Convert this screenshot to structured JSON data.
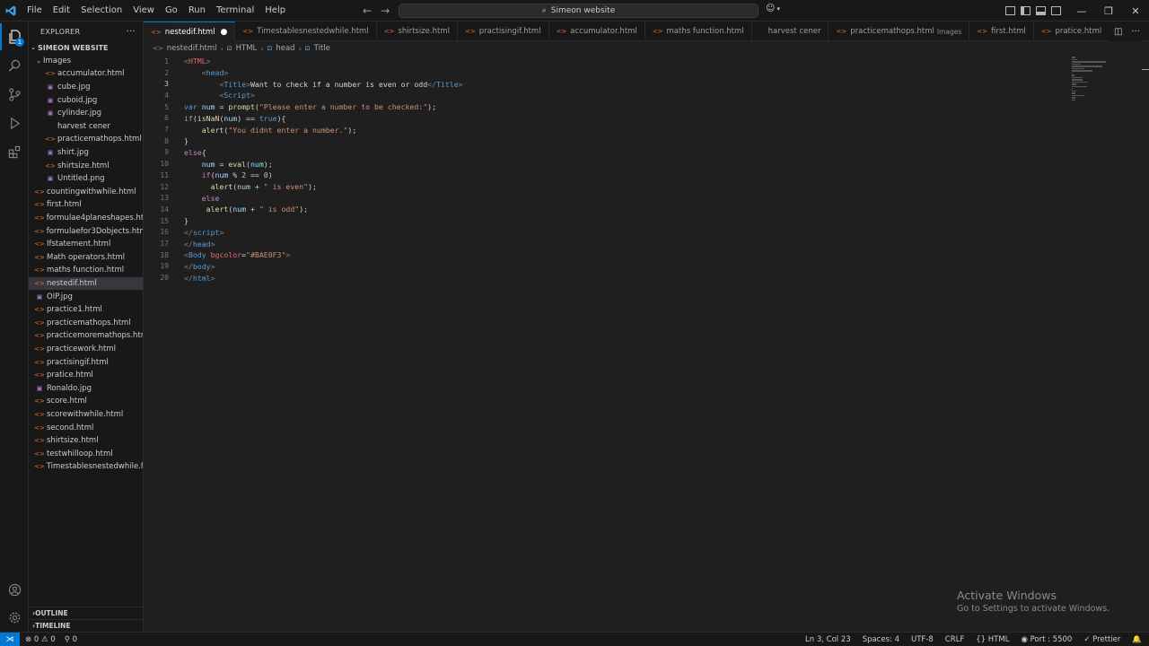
{
  "menu": [
    "File",
    "Edit",
    "Selection",
    "View",
    "Go",
    "Run",
    "Terminal",
    "Help"
  ],
  "command_center": "Simeon website",
  "explorer": {
    "title": "EXPLORER",
    "root": "SIMEON WEBSITE",
    "items": [
      {
        "label": "Images",
        "kind": "folder",
        "indent": 1
      },
      {
        "label": "accumulator.html",
        "kind": "html",
        "indent": 2
      },
      {
        "label": "cube.jpg",
        "kind": "img",
        "indent": 2
      },
      {
        "label": "cuboid.jpg",
        "kind": "img",
        "indent": 2
      },
      {
        "label": "cylinder.jpg",
        "kind": "img",
        "indent": 2
      },
      {
        "label": "harvest cener",
        "kind": "none",
        "indent": 2
      },
      {
        "label": "practicemathops.html",
        "kind": "html",
        "indent": 2
      },
      {
        "label": "shirt.jpg",
        "kind": "img",
        "indent": 2
      },
      {
        "label": "shirtsize.html",
        "kind": "html",
        "indent": 2
      },
      {
        "label": "Untitled.png",
        "kind": "img",
        "indent": 2
      },
      {
        "label": "countingwithwhile.html",
        "kind": "html",
        "indent": 1
      },
      {
        "label": "first.html",
        "kind": "html",
        "indent": 1
      },
      {
        "label": "formulae4planeshapes.ht...",
        "kind": "html",
        "indent": 1
      },
      {
        "label": "formulaefor3Dobjects.html",
        "kind": "html",
        "indent": 1
      },
      {
        "label": "Ifstatement.html",
        "kind": "html",
        "indent": 1
      },
      {
        "label": "Math operators.html",
        "kind": "html",
        "indent": 1
      },
      {
        "label": "maths function.html",
        "kind": "html",
        "indent": 1
      },
      {
        "label": "nestedif.html",
        "kind": "html",
        "indent": 1,
        "selected": true
      },
      {
        "label": "OIP.jpg",
        "kind": "img",
        "indent": 1
      },
      {
        "label": "practice1.html",
        "kind": "html",
        "indent": 1
      },
      {
        "label": "practicemathops.html",
        "kind": "html",
        "indent": 1
      },
      {
        "label": "practicemoremathops.html",
        "kind": "html",
        "indent": 1
      },
      {
        "label": "practicework.html",
        "kind": "html",
        "indent": 1
      },
      {
        "label": "practisingif.html",
        "kind": "html",
        "indent": 1
      },
      {
        "label": "pratice.html",
        "kind": "html",
        "indent": 1
      },
      {
        "label": "Ronaldo.jpg",
        "kind": "img",
        "indent": 1
      },
      {
        "label": "score.html",
        "kind": "html",
        "indent": 1
      },
      {
        "label": "scorewithwhile.html",
        "kind": "html",
        "indent": 1
      },
      {
        "label": "second.html",
        "kind": "html",
        "indent": 1
      },
      {
        "label": "shirtsize.html",
        "kind": "html",
        "indent": 1
      },
      {
        "label": "testwhilloop.html",
        "kind": "html",
        "indent": 1
      },
      {
        "label": "Timestablesnestedwhile.h...",
        "kind": "html",
        "indent": 1
      }
    ],
    "outline": "OUTLINE",
    "timeline": "TIMELINE"
  },
  "tabs": [
    {
      "label": "nestedif.html",
      "active": true,
      "dirty": true
    },
    {
      "label": "Timestablesnestedwhile.html"
    },
    {
      "label": "shirtsize.html"
    },
    {
      "label": "practisingif.html"
    },
    {
      "label": "accumulator.html"
    },
    {
      "label": "maths function.html"
    },
    {
      "label": "harvest cener",
      "noicon": true
    },
    {
      "label": "practicemathops.html",
      "desc": "Images"
    },
    {
      "label": "first.html"
    },
    {
      "label": "pratice.html"
    }
  ],
  "breadcrumb": [
    "nestedif.html",
    "HTML",
    "head",
    "Title"
  ],
  "editor": {
    "current_line": 3,
    "lines": [
      [
        [
          "brk",
          "<"
        ],
        [
          "html",
          "HTML"
        ],
        [
          "brk",
          ">"
        ]
      ],
      [
        [
          "plain",
          "    "
        ],
        [
          "brk",
          "<"
        ],
        [
          "tag",
          "head"
        ],
        [
          "brk",
          ">"
        ]
      ],
      [
        [
          "plain",
          "        "
        ],
        [
          "brk",
          "<"
        ],
        [
          "tag",
          "Title"
        ],
        [
          "brk",
          ">"
        ],
        [
          "plain",
          "Want to check if a number is even or odd"
        ],
        [
          "brk",
          "</"
        ],
        [
          "tag",
          "Title"
        ],
        [
          "brk",
          ">"
        ]
      ],
      [
        [
          "plain",
          "        "
        ],
        [
          "brk",
          "<"
        ],
        [
          "tag",
          "Script"
        ],
        [
          "brk",
          ">"
        ]
      ],
      [
        [
          "tag",
          "var"
        ],
        [
          "plain",
          " "
        ],
        [
          "var",
          "num"
        ],
        [
          "plain",
          " = "
        ],
        [
          "fn",
          "prompt"
        ],
        [
          "plain",
          "("
        ],
        [
          "str",
          "\"Please enter a number to be checked:\""
        ],
        [
          "plain",
          ");"
        ]
      ],
      [
        [
          "kw",
          "if"
        ],
        [
          "plain",
          "("
        ],
        [
          "fn",
          "isNaN"
        ],
        [
          "plain",
          "("
        ],
        [
          "var",
          "num"
        ],
        [
          "plain",
          ") == "
        ],
        [
          "tag",
          "true"
        ],
        [
          "plain",
          "){"
        ]
      ],
      [
        [
          "plain",
          "    "
        ],
        [
          "fn",
          "alert"
        ],
        [
          "plain",
          "("
        ],
        [
          "str",
          "\"You didnt enter a number.\""
        ],
        [
          "plain",
          ");"
        ]
      ],
      [
        [
          "plain",
          "}"
        ]
      ],
      [
        [
          "kw",
          "else"
        ],
        [
          "plain",
          "{"
        ]
      ],
      [
        [
          "plain",
          "    "
        ],
        [
          "var",
          "num"
        ],
        [
          "plain",
          " = "
        ],
        [
          "fn",
          "eval"
        ],
        [
          "plain",
          "("
        ],
        [
          "var",
          "num"
        ],
        [
          "plain",
          ");"
        ]
      ],
      [
        [
          "plain",
          "    "
        ],
        [
          "kw",
          "if"
        ],
        [
          "plain",
          "("
        ],
        [
          "var",
          "num"
        ],
        [
          "plain",
          " % "
        ],
        [
          "num",
          "2"
        ],
        [
          "plain",
          " == "
        ],
        [
          "num",
          "0"
        ],
        [
          "plain",
          ")"
        ]
      ],
      [
        [
          "plain",
          "      "
        ],
        [
          "fn",
          "alert"
        ],
        [
          "plain",
          "("
        ],
        [
          "var",
          "num"
        ],
        [
          "plain",
          " + "
        ],
        [
          "str",
          "\" is even\""
        ],
        [
          "plain",
          ");"
        ]
      ],
      [
        [
          "plain",
          "    "
        ],
        [
          "kw",
          "else"
        ]
      ],
      [
        [
          "plain",
          "     "
        ],
        [
          "fn",
          "alert"
        ],
        [
          "plain",
          "("
        ],
        [
          "var",
          "num"
        ],
        [
          "plain",
          " + "
        ],
        [
          "str",
          "\" is odd\""
        ],
        [
          "plain",
          ");"
        ]
      ],
      [
        [
          "plain",
          "}"
        ]
      ],
      [
        [
          "brk",
          "</"
        ],
        [
          "tag",
          "script"
        ],
        [
          "brk",
          ">"
        ]
      ],
      [
        [
          "brk",
          "</"
        ],
        [
          "tag",
          "head"
        ],
        [
          "brk",
          ">"
        ]
      ],
      [
        [
          "brk",
          "<"
        ],
        [
          "tag",
          "Body"
        ],
        [
          "plain",
          " "
        ],
        [
          "html",
          "bgcolor"
        ],
        [
          "plain",
          "="
        ],
        [
          "str",
          "\"#BAE0F3\""
        ],
        [
          "brk",
          ">"
        ]
      ],
      [
        [
          "brk",
          "</"
        ],
        [
          "tag",
          "body"
        ],
        [
          "brk",
          ">"
        ]
      ],
      [
        [
          "brk",
          "</"
        ],
        [
          "tag",
          "html"
        ],
        [
          "brk",
          ">"
        ]
      ]
    ]
  },
  "watermark": {
    "line1": "Activate Windows",
    "line2": "Go to Settings to activate Windows."
  },
  "status": {
    "errors": "0",
    "warnings": "0",
    "ports": "0",
    "position": "Ln 3, Col 23",
    "spaces": "Spaces: 4",
    "encoding": "UTF-8",
    "eol": "CRLF",
    "language": "HTML",
    "port": "Port : 5500",
    "formatter": "Prettier"
  },
  "colors": {
    "accent": "#0078d4",
    "html_icon": "#e37933",
    "image_icon": "#a074c4"
  }
}
